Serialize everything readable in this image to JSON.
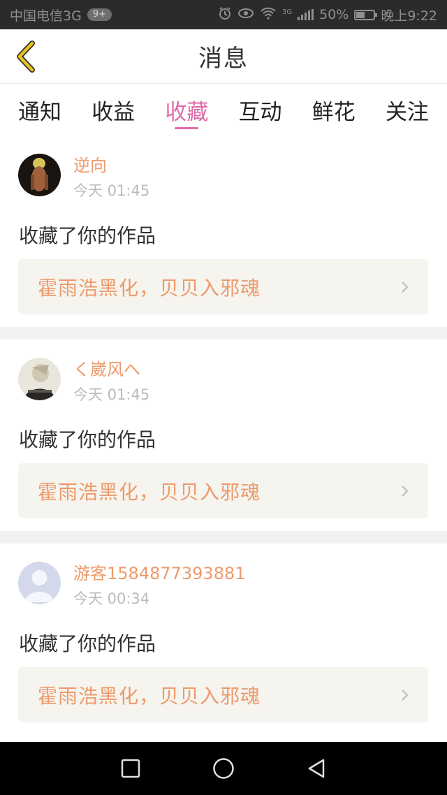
{
  "status_bar": {
    "carrier": "中国电信3G",
    "badge": "9+",
    "network_type": "3G",
    "battery": "50%",
    "battery_level": 0.5,
    "time": "晚上9:22"
  },
  "header": {
    "title": "消息"
  },
  "tabs": [
    {
      "label": "通知",
      "active": false
    },
    {
      "label": "收益",
      "active": false
    },
    {
      "label": "收藏",
      "active": true
    },
    {
      "label": "互动",
      "active": false
    },
    {
      "label": "鲜花",
      "active": false
    },
    {
      "label": "关注",
      "active": false
    }
  ],
  "messages": [
    {
      "username": "逆向",
      "time": "今天 01:45",
      "action": "收藏了你的作品",
      "work_title": "霍雨浩黑化，贝贝入邪魂"
    },
    {
      "username": "く崴风へ",
      "time": "今天 01:45",
      "action": "收藏了你的作品",
      "work_title": "霍雨浩黑化，贝贝入邪魂"
    },
    {
      "username": "游客1584877393881",
      "time": "今天 00:34",
      "action": "收藏了你的作品",
      "work_title": "霍雨浩黑化，贝贝入邪魂"
    }
  ],
  "colors": {
    "accent": "#e06aa8",
    "username": "#ee9a6a",
    "back_icon": "#e8c21e"
  }
}
